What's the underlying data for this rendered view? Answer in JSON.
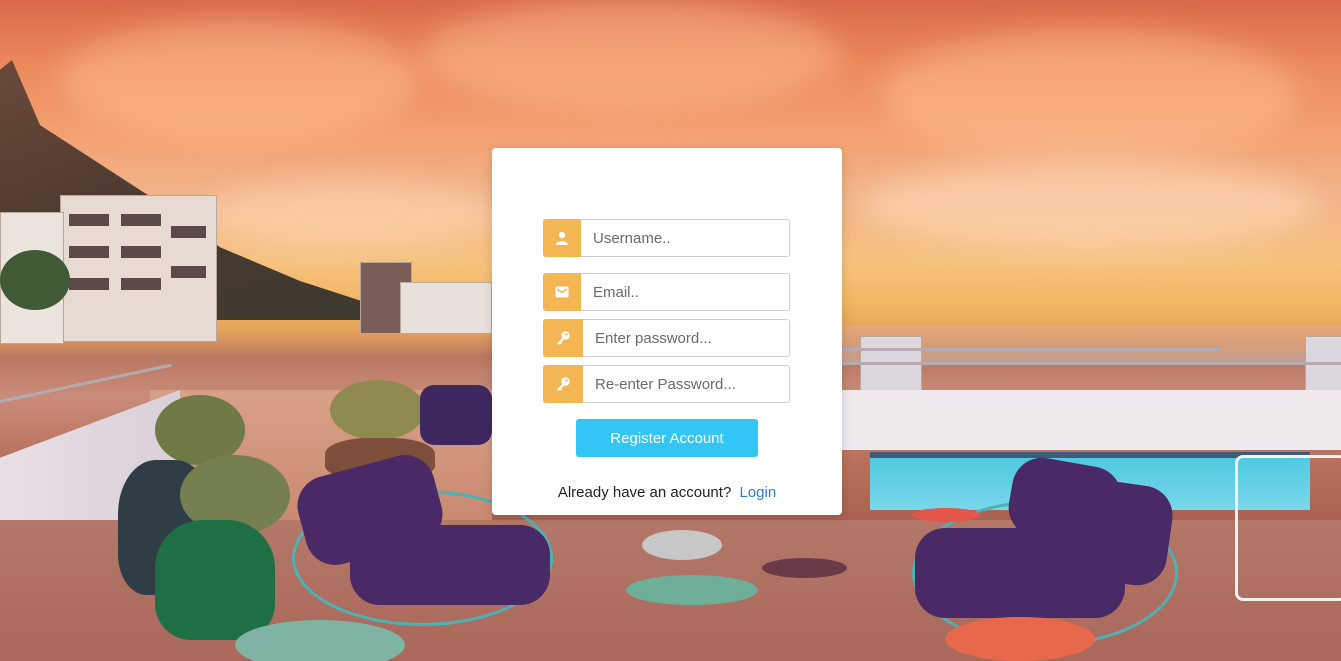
{
  "form": {
    "username_placeholder": "Username..",
    "email_placeholder": "Email..",
    "password_placeholder": "Enter password...",
    "repassword_placeholder": "Re-enter Password...",
    "register_label": "Register Account",
    "login_prompt": "Already have an account?",
    "login_link": "Login"
  },
  "icons": {
    "username": "user-icon",
    "email": "envelope-icon",
    "password": "key-icon",
    "repassword": "key-icon"
  },
  "colors": {
    "addon": "#f4b553",
    "button": "#33c6f4",
    "link": "#2a7dd1"
  }
}
